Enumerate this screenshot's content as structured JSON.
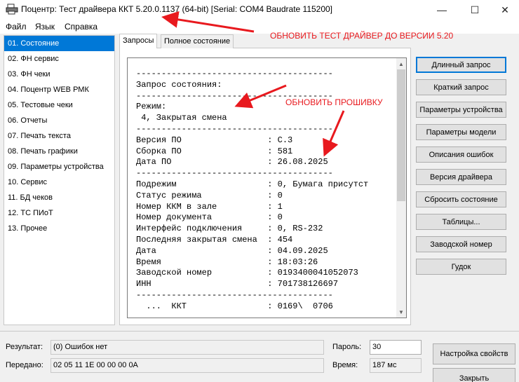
{
  "window": {
    "title": "Поцентр: Тест драйвера ККТ 5.20.0.1137 (64-bit) [Serial: COM4 Baudrate 115200]",
    "minimize": "—",
    "maximize": "☐",
    "close": "✕"
  },
  "menu": [
    "Файл",
    "Язык",
    "Справка"
  ],
  "sidebar": {
    "selected_index": 0,
    "items": [
      "01. Состояние",
      "02. ФН сервис",
      "03. ФН чеки",
      "04. Поцентр WEB РМК",
      "05. Тестовые чеки",
      "06. Отчеты",
      "07. Печать текста",
      "08. Печать графики",
      "09. Параметры устройства",
      "10. Сервис",
      "11. БД чеков",
      "12. ТС ПИоТ",
      "13. Прочее"
    ]
  },
  "tabs": [
    "Запросы",
    "Полное состояние"
  ],
  "report_lines": [
    "---------------------------------------",
    "Запрос состояния:",
    "---------------------------------------",
    "Режим:",
    " 4, Закрытая смена",
    "---------------------------------------",
    "Версия ПО                 : C.3",
    "Сборка ПО                 : 581",
    "Дата ПО                   : 26.08.2025",
    "---------------------------------------",
    "Подрежим                  : 0, Бумага присутст",
    "Статус режима             : 0",
    "Номер ККМ в зале          : 1",
    "Номер документа           : 0",
    "Интерфейс подключения     : 0, RS-232",
    "Последняя закрытая смена  : 454",
    "Дата                      : 04.09.2025",
    "Время                     : 18:03:26",
    "Заводской номер           : 0193400041052073",
    "ИНН                       : 701738126697",
    "---------------------------------------",
    "  ...  ККТ                : 0169\\  0706"
  ],
  "action_buttons": [
    "Длинный запрос",
    "Краткий запрос",
    "Параметры устройства",
    "Параметры модели",
    "Описания ошибок",
    "Версия драйвера",
    "Сбросить состояние",
    "Таблицы...",
    "Заводской номер",
    "Гудок"
  ],
  "status": {
    "result_label": "Результат:",
    "result_value": "(0) Ошибок нет",
    "sent_label": "Передано:",
    "sent_value": "02 05 11 1E 00 00 00 0A",
    "password_label": "Пароль:",
    "password_value": "30",
    "time_label": "Время:",
    "time_value": "187 мс",
    "settings_button": "Настройка свойств",
    "close_button": "Закрыть"
  },
  "annotations": {
    "update_driver": "ОБНОВИТЬ ТЕСТ ДРАЙВЕР ДО ВЕРСИИ 5.20",
    "update_firmware": "ОБНОВИТЬ ПРОШИВКУ",
    "color": "#e8191e"
  },
  "icons": {
    "app": "printer-icon",
    "scroll_up": "chevron-up-icon",
    "scroll_down": "chevron-down-icon"
  }
}
